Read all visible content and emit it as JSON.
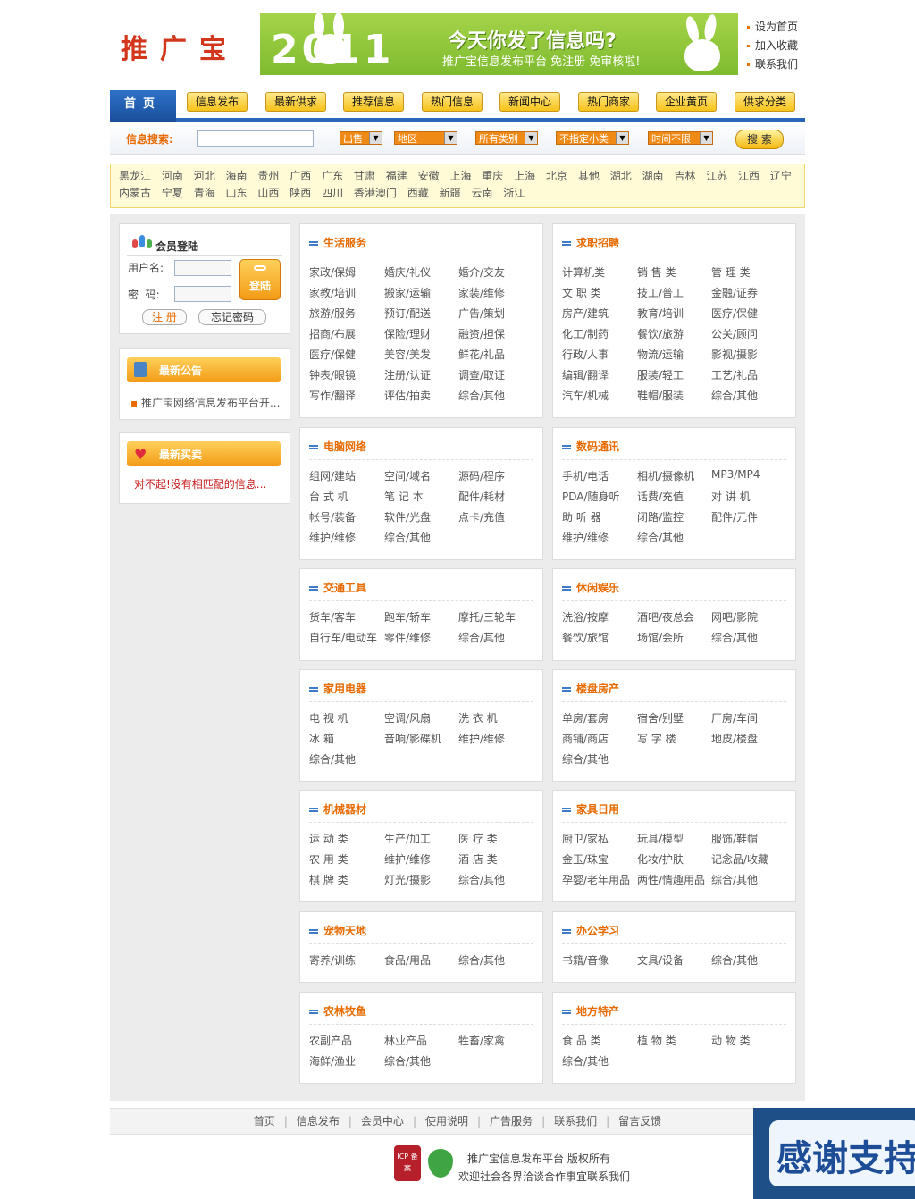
{
  "header": {
    "logo": "推广宝",
    "banner_year": "2011",
    "banner_main": "今天你发了信息吗?",
    "banner_sub": "推广宝信息发布平台 免注册 免审核啦!",
    "top_links": [
      "设为首页",
      "加入收藏",
      "联系我们"
    ]
  },
  "nav": {
    "home": "首页",
    "items": [
      "信息发布",
      "最新供求",
      "推荐信息",
      "热门信息",
      "新闻中心",
      "热门商家",
      "企业黄页",
      "供求分类"
    ]
  },
  "search": {
    "label": "信息搜索:",
    "selects": [
      "出售",
      "地区",
      "所有类别",
      "不指定小类",
      "时间不限"
    ],
    "button": "搜 索"
  },
  "regions": [
    "黑龙江",
    "河南",
    "河北",
    "海南",
    "贵州",
    "广西",
    "广东",
    "甘肃",
    "福建",
    "安徽",
    "上海",
    "重庆",
    "上海",
    "北京",
    "其他",
    "湖北",
    "湖南",
    "吉林",
    "江苏",
    "江西",
    "辽宁",
    "内蒙古",
    "宁夏",
    "青海",
    "山东",
    "山西",
    "陕西",
    "四川",
    "香港澳门",
    "西藏",
    "新疆",
    "云南",
    "浙江"
  ],
  "login": {
    "title": "会员登陆",
    "username_label": "用户名:",
    "password_label": "密  码:",
    "login_button": "登陆",
    "register": "注 册",
    "forgot": "忘记密码"
  },
  "notice": {
    "title": "最新公告",
    "item": "推广宝网络信息发布平台开..."
  },
  "trade": {
    "title": "最新买卖",
    "item": "对不起!没有相匹配的信息..."
  },
  "sections": [
    {
      "title": "生活服务",
      "items": [
        "家政/保姆",
        "婚庆/礼仪",
        "婚介/交友",
        "家教/培训",
        "搬家/运输",
        "家装/维修",
        "旅游/服务",
        "预订/配送",
        "广告/策划",
        "招商/布展",
        "保险/理财",
        "融资/担保",
        "医疗/保健",
        "美容/美发",
        "鲜花/礼品",
        "钟表/眼镜",
        "注册/认证",
        "调查/取证",
        "写作/翻译",
        "评估/拍卖",
        "综合/其他"
      ]
    },
    {
      "title": "求职招聘",
      "items": [
        "计算机类",
        "销 售 类",
        "管 理 类",
        "文 职 类",
        "技工/普工",
        "金融/证券",
        "房产/建筑",
        "教育/培训",
        "医疗/保健",
        "化工/制药",
        "餐饮/旅游",
        "公关/顾问",
        "行政/人事",
        "物流/运输",
        "影视/摄影",
        "编辑/翻译",
        "服装/轻工",
        "工艺/礼品",
        "汽车/机械",
        "鞋帽/服装",
        "综合/其他"
      ]
    },
    {
      "title": "电脑网络",
      "items": [
        "组网/建站",
        "空间/域名",
        "源码/程序",
        "台 式 机",
        "笔 记 本",
        "配件/耗材",
        "帐号/装备",
        "软件/光盘",
        "点卡/充值",
        "维护/维修",
        "综合/其他"
      ]
    },
    {
      "title": "数码通讯",
      "items": [
        "手机/电话",
        "相机/摄像机",
        "MP3/MP4",
        "PDA/随身听",
        "话费/充值",
        "对 讲 机",
        "助 听 器",
        "闭路/监控",
        "配件/元件",
        "维护/维修",
        "综合/其他"
      ]
    },
    {
      "title": "交通工具",
      "items": [
        "货车/客车",
        "跑车/轿车",
        "摩托/三轮车",
        "自行车/电动车",
        "零件/维修",
        "综合/其他"
      ]
    },
    {
      "title": "休闲娱乐",
      "items": [
        "洗浴/按摩",
        "酒吧/夜总会",
        "网吧/影院",
        "餐饮/旅馆",
        "场馆/会所",
        "综合/其他"
      ]
    },
    {
      "title": "家用电器",
      "items": [
        "电 视 机",
        "空调/风扇",
        "洗 衣 机",
        "冰 箱",
        "音响/影碟机",
        "维护/维修",
        "综合/其他"
      ]
    },
    {
      "title": "楼盘房产",
      "items": [
        "单房/套房",
        "宿舍/别墅",
        "厂房/车间",
        "商铺/商店",
        "写 字 楼",
        "地皮/楼盘",
        "综合/其他"
      ]
    },
    {
      "title": "机械器材",
      "items": [
        "运 动 类",
        "生产/加工",
        "医 疗 类",
        "农 用 类",
        "维护/维修",
        "酒 店 类",
        "棋 牌 类",
        "灯光/摄影",
        "综合/其他"
      ]
    },
    {
      "title": "家具日用",
      "items": [
        "厨卫/家私",
        "玩具/模型",
        "服饰/鞋帽",
        "金玉/珠宝",
        "化妆/护肤",
        "记念品/收藏",
        "孕婴/老年用品",
        "两性/情趣用品",
        "综合/其他"
      ]
    },
    {
      "title": "宠物天地",
      "items": [
        "寄养/训练",
        "食品/用品",
        "综合/其他"
      ]
    },
    {
      "title": "办公学习",
      "items": [
        "书籍/音像",
        "文具/设备",
        "综合/其他"
      ]
    },
    {
      "title": "农林牧鱼",
      "items": [
        "农副产品",
        "林业产品",
        "牲畜/家禽",
        "海鲜/渔业",
        "综合/其他"
      ]
    },
    {
      "title": "地方特产",
      "items": [
        "食 品 类",
        "植 物 类",
        "动 物 类",
        "综合/其他"
      ]
    }
  ],
  "footer": {
    "links": [
      "首页",
      "信息发布",
      "会员中心",
      "使用说明",
      "广告服务",
      "联系我们",
      "留言反馈"
    ],
    "line1": "推广宝信息发布平台 版权所有",
    "line2": "欢迎社会各界洽谈合作事宜联系我们",
    "badge": "ICP 备案",
    "thanks": "感谢支持"
  }
}
